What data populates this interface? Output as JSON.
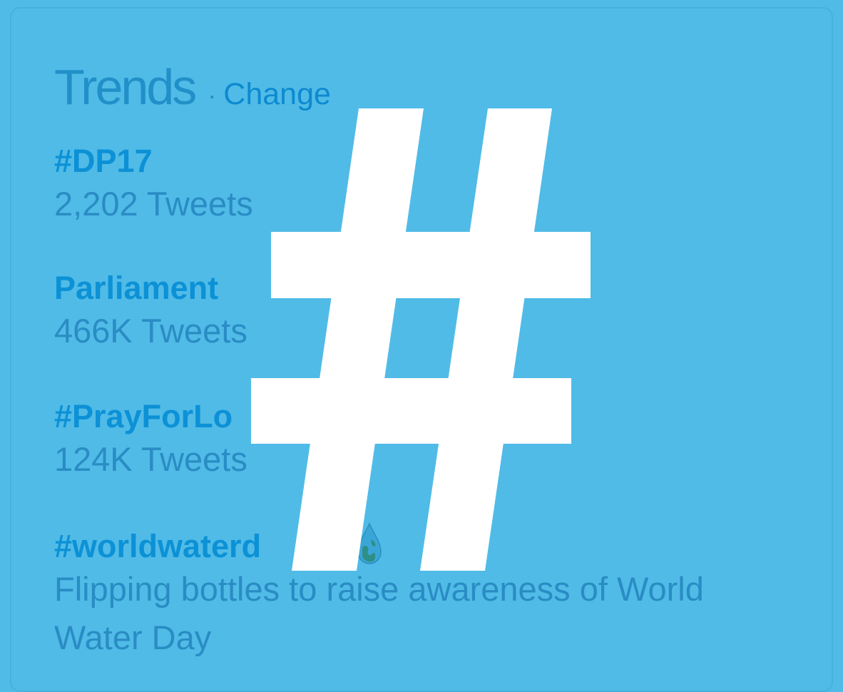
{
  "header": {
    "title": "Trends",
    "separator": "·",
    "change_label": "Change"
  },
  "trends": [
    {
      "name": "#DP17",
      "meta": "2,202 Tweets"
    },
    {
      "name": "Parliament",
      "meta": "466K Tweets"
    },
    {
      "name": "#PrayForLo",
      "meta": "124K Tweets"
    },
    {
      "name": "#worldwaterd",
      "description": "Flipping bottles to raise awareness of World Water Day"
    }
  ],
  "icons": {
    "overlay": "hashtag-icon",
    "emoji": "globe-icon"
  },
  "colors": {
    "background": "#50bbe7",
    "title": "#2190c8",
    "link": "#0c91d6",
    "meta": "#2a8cc4",
    "overlay": "#ffffff"
  }
}
